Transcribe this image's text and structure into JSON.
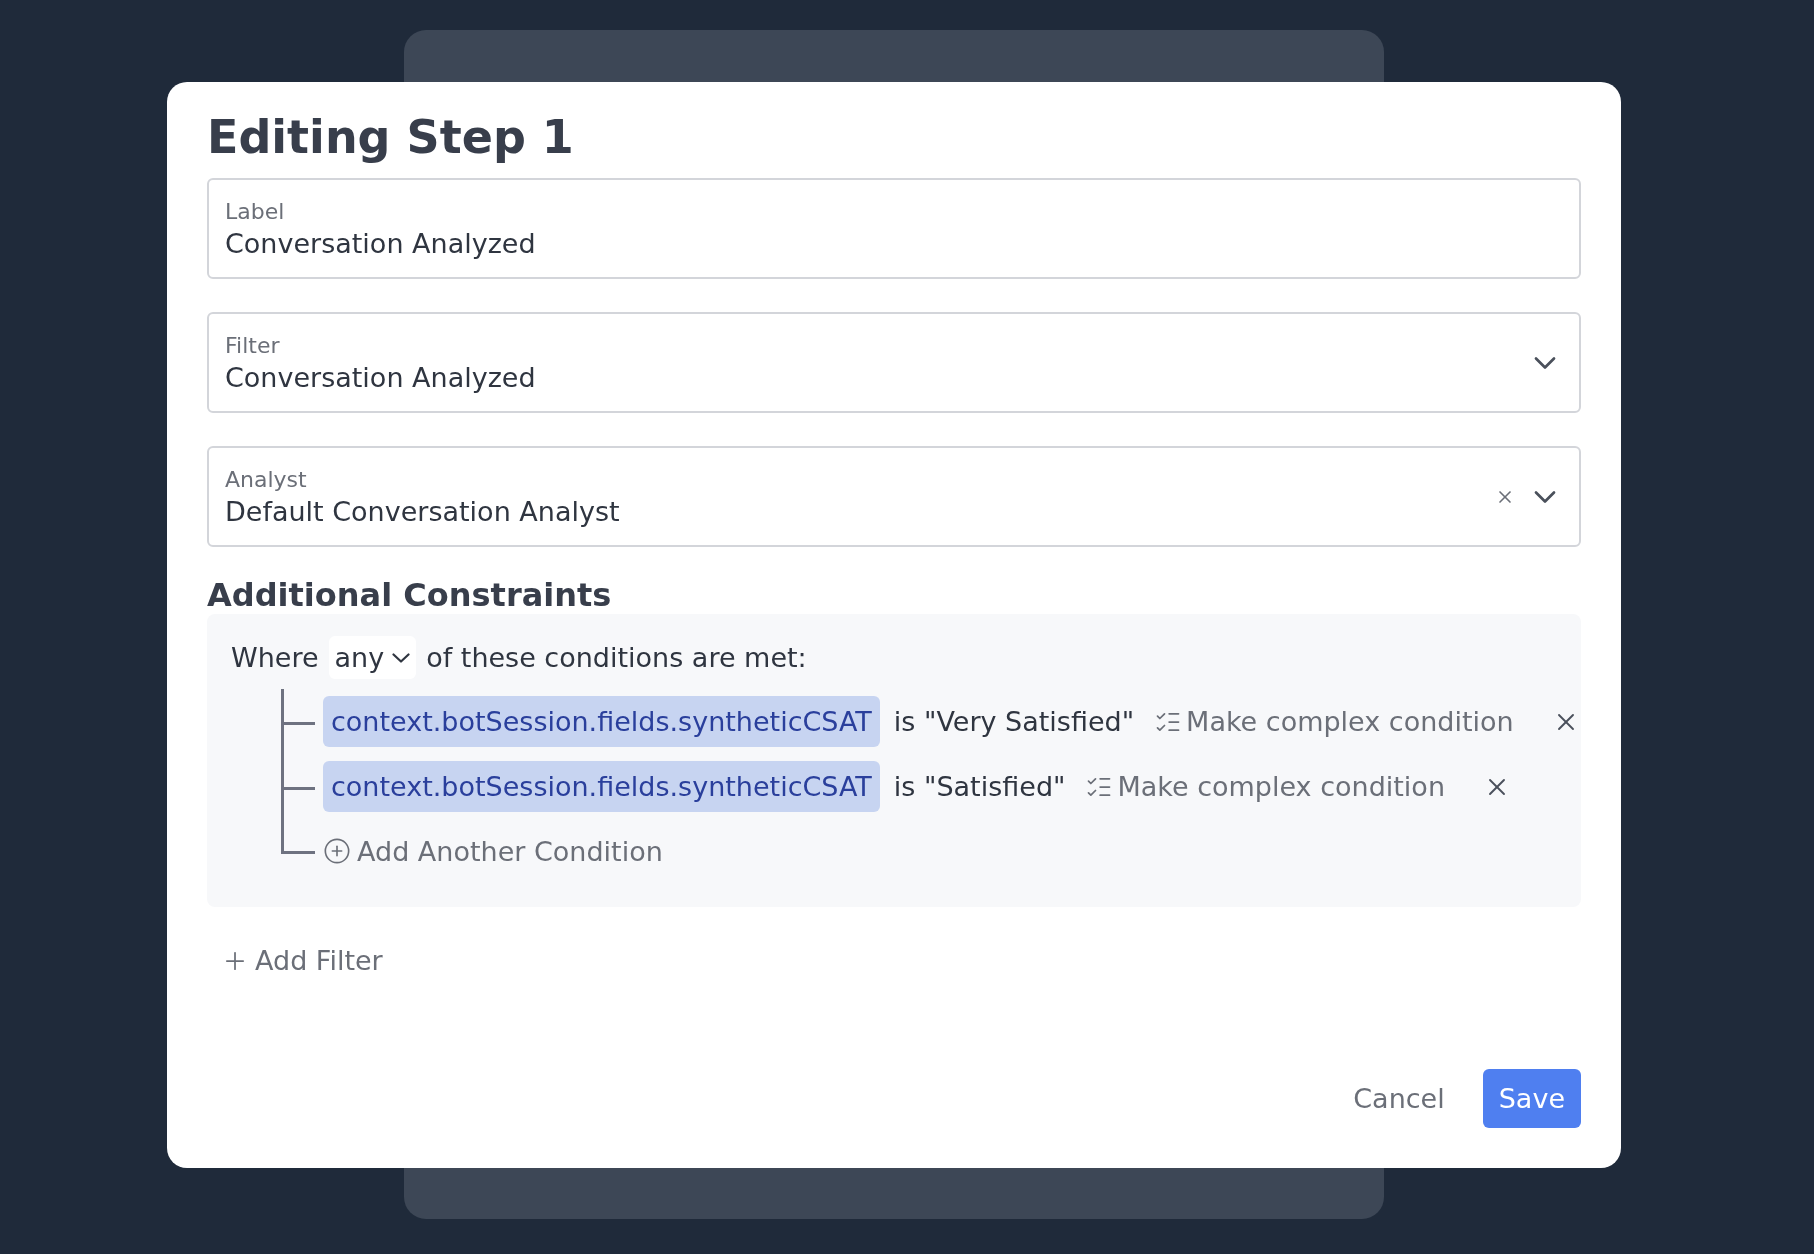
{
  "dialog": {
    "title": "Editing Step 1",
    "fields": [
      {
        "kind": "text",
        "label": "Label",
        "value": "Conversation Analyzed",
        "clearable": false
      },
      {
        "kind": "select",
        "label": "Filter",
        "value": "Conversation Analyzed",
        "clearable": false
      },
      {
        "kind": "select",
        "label": "Analyst",
        "value": "Default Conversation Analyst",
        "clearable": true
      }
    ],
    "constraints": {
      "heading": "Additional Constraints",
      "prefix": "Where",
      "quantifier": "any",
      "suffix": "of these conditions are met:",
      "conditions": [
        {
          "field": "context.botSession.fields.syntheticCSAT",
          "comparison": "is \"Very Satisfied\"",
          "action": "Make complex condition"
        },
        {
          "field": "context.botSession.fields.syntheticCSAT",
          "comparison": "is \"Satisfied\"",
          "action": "Make complex condition"
        }
      ],
      "add_condition": "Add Another Condition"
    },
    "add_filter": "Add Filter",
    "buttons": [
      {
        "kind": "secondary",
        "label": "Cancel"
      },
      {
        "kind": "primary",
        "label": "Save"
      }
    ]
  }
}
